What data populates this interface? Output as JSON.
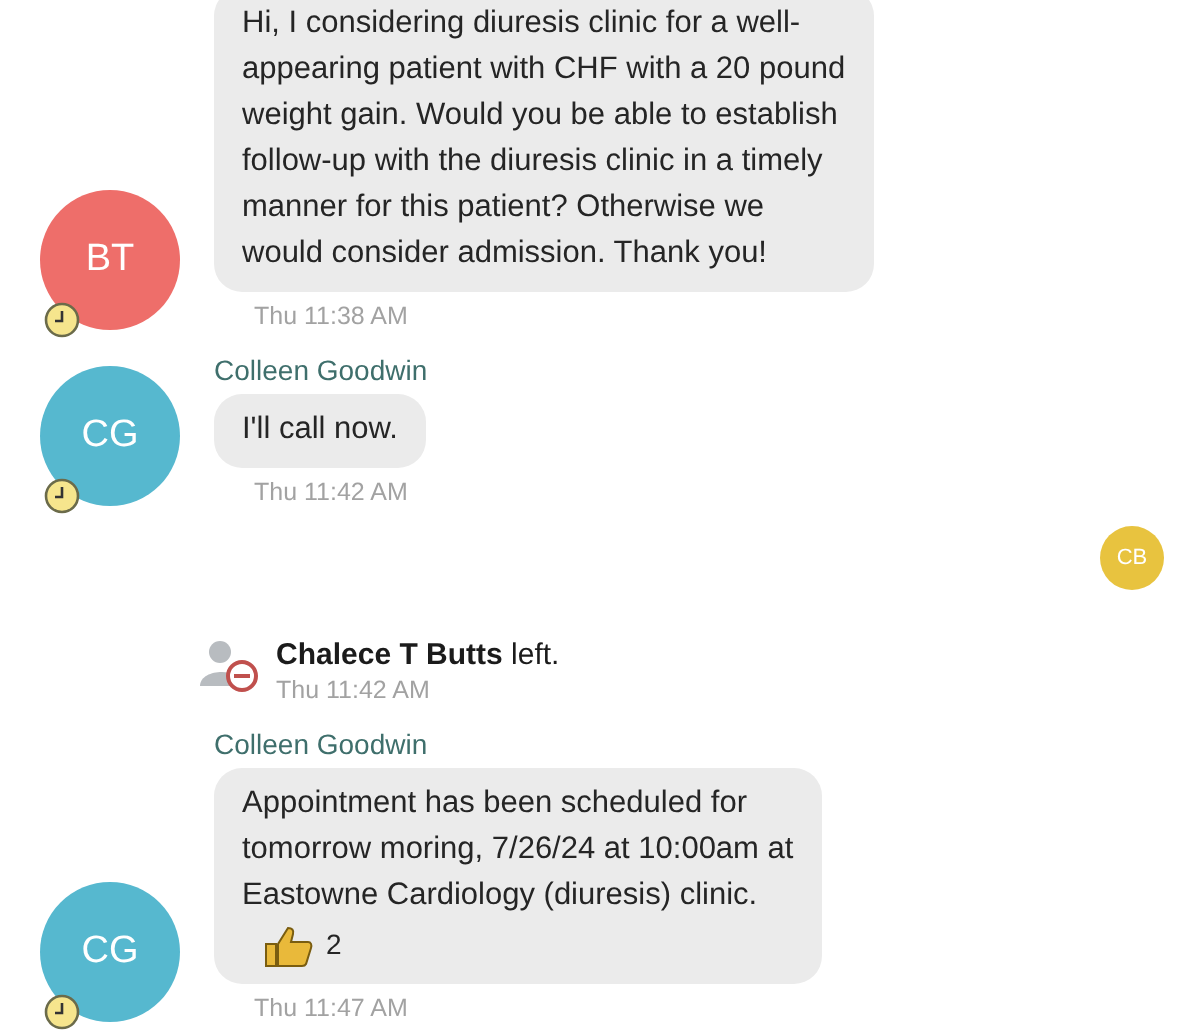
{
  "messages": [
    {
      "kind": "message",
      "initials": "BT",
      "color": "#ee6e6a",
      "lines": [
        "Hi, I considering diuresis clinic for a well-",
        "appearing patient with CHF with a 20 pound",
        "weight gain.  Would you be able to establish",
        "follow-up with the diuresis clinic in a timely",
        "manner for this patient?  Otherwise we",
        "would consider admission.  Thank you!"
      ],
      "time": "Thu 11:38 AM"
    },
    {
      "kind": "message",
      "sender": "Colleen Goodwin",
      "initials": "CG",
      "color": "#56b8cf",
      "lines": [
        "I'll call now."
      ],
      "time": "Thu 11:42 AM"
    },
    {
      "kind": "receipt",
      "initials": "CB",
      "color": "#e8c33f"
    },
    {
      "kind": "system",
      "text": "**Chalece T Butts** left.",
      "time": "Thu 11:42 AM"
    },
    {
      "kind": "message",
      "sender": "Colleen Goodwin",
      "initials": "CG",
      "color": "#56b8cf",
      "lines": [
        "Appointment has been scheduled for",
        "tomorrow moring, 7/26/24 at 10:00am at",
        "Eastowne Cardiology (diuresis) clinic."
      ],
      "reaction": {
        "count": "2"
      },
      "time": "Thu 11:47 AM"
    }
  ]
}
